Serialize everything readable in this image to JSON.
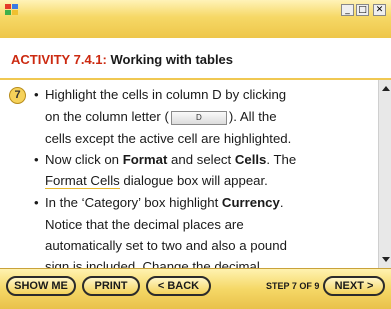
{
  "window": {
    "controls": {
      "minimize": "_",
      "restore": "□",
      "close": "✕"
    }
  },
  "activity": {
    "label": "ACTIVITY 7.4.1:",
    "title": "Working with tables"
  },
  "step": {
    "number": "7",
    "lines": {
      "l1": "Highlight the cells in column D by clicking",
      "l2a": "on the column letter (",
      "l2btn": "D",
      "l2b": "). All the",
      "l3": "cells except the active cell are highlighted.",
      "l4a": "Now click on ",
      "l4b": "Format",
      "l4c": " and select ",
      "l4d": "Cells",
      "l4e": ". The",
      "l5a": "Format Cells",
      "l5b": " dialogue box will appear.",
      "l6a": "In the ‘Category’ box highlight ",
      "l6b": "Currency",
      "l6c": ".",
      "l7": "Notice that the decimal places are",
      "l8": "automatically set to two and also a pound",
      "l9": "sign is included. Change the decimal"
    }
  },
  "footer": {
    "show_me": "SHOW ME",
    "print": "PRINT",
    "back": "< BACK",
    "step_counter": "STEP 7 OF 9",
    "next": "NEXT >"
  },
  "colors": {
    "accent_gold": "#f5d867",
    "heading_red": "#cc2a11"
  }
}
